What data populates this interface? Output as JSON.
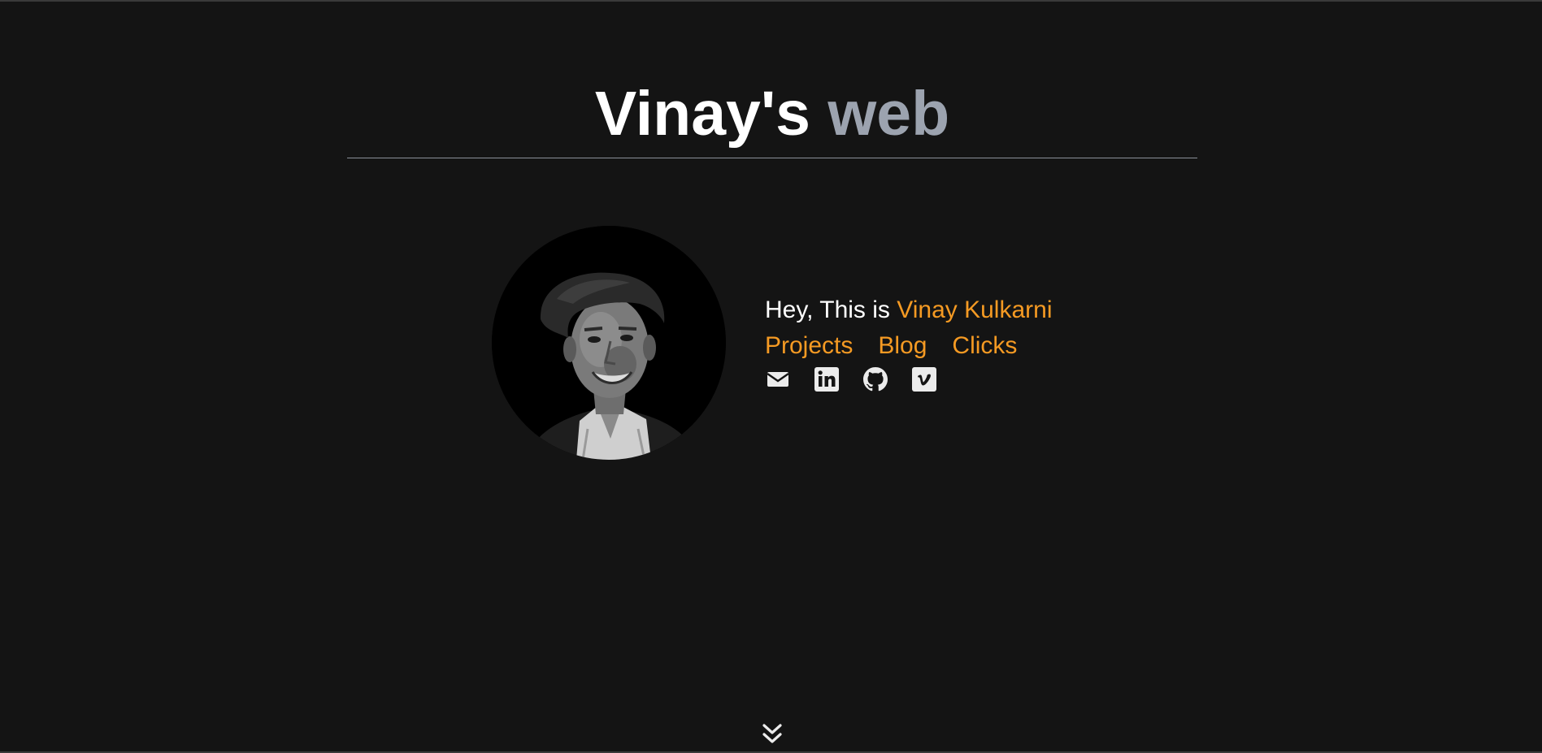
{
  "header": {
    "title_main": "Vinay's",
    "title_accent": "web"
  },
  "profile": {
    "avatar_icon": "portrait-avatar"
  },
  "intro": {
    "greeting": "Hey, This is ",
    "name": "Vinay Kulkarni"
  },
  "nav": {
    "items": [
      {
        "label": "Projects"
      },
      {
        "label": "Blog"
      },
      {
        "label": "Clicks"
      }
    ]
  },
  "socials": [
    {
      "icon": "mail-icon"
    },
    {
      "icon": "linkedin-icon"
    },
    {
      "icon": "github-icon"
    },
    {
      "icon": "vimeo-icon"
    }
  ],
  "colors": {
    "background": "#141414",
    "accent": "#f59a23",
    "title_accent": "#9ca3af",
    "text": "#ffffff"
  },
  "scroll": {
    "icon": "chevrons-down-icon"
  }
}
